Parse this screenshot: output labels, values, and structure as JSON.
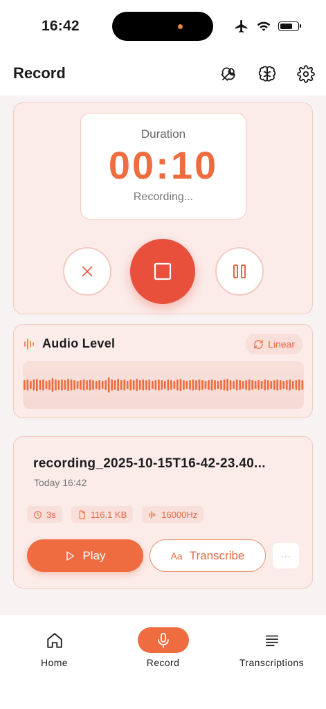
{
  "status_bar": {
    "time": "16:42"
  },
  "header": {
    "title": "Record",
    "icons": [
      "wrench-icon",
      "brain-icon",
      "gear-icon"
    ]
  },
  "recorder": {
    "duration_label": "Duration",
    "duration_value": "00:10",
    "status": "Recording...",
    "controls": [
      "cancel-icon",
      "stop-icon",
      "pause-icon"
    ]
  },
  "audio_level": {
    "title": "Audio Level",
    "mode_label": "Linear"
  },
  "recording": {
    "file_name": "recording_2025-10-15T16-42-23.40...",
    "date": "Today 16:42",
    "chips": [
      {
        "icon": "clock-icon",
        "label": "3s"
      },
      {
        "icon": "file-icon",
        "label": "116.1 KB"
      },
      {
        "icon": "waveform-icon",
        "label": "16000Hz"
      }
    ],
    "play_label": "Play",
    "transcribe_label": "Transcribe",
    "more_label": "···"
  },
  "tabs": [
    {
      "label": "Home",
      "icon": "home-icon",
      "active": false
    },
    {
      "label": "Record",
      "icon": "microphone-icon",
      "active": true
    },
    {
      "label": "Transcriptions",
      "icon": "list-icon",
      "active": false
    }
  ],
  "colors": {
    "accent": "#ee6c3f",
    "stop": "#e8503c",
    "card_bg": "#fbecea",
    "card_border": "#f2c9c1"
  }
}
